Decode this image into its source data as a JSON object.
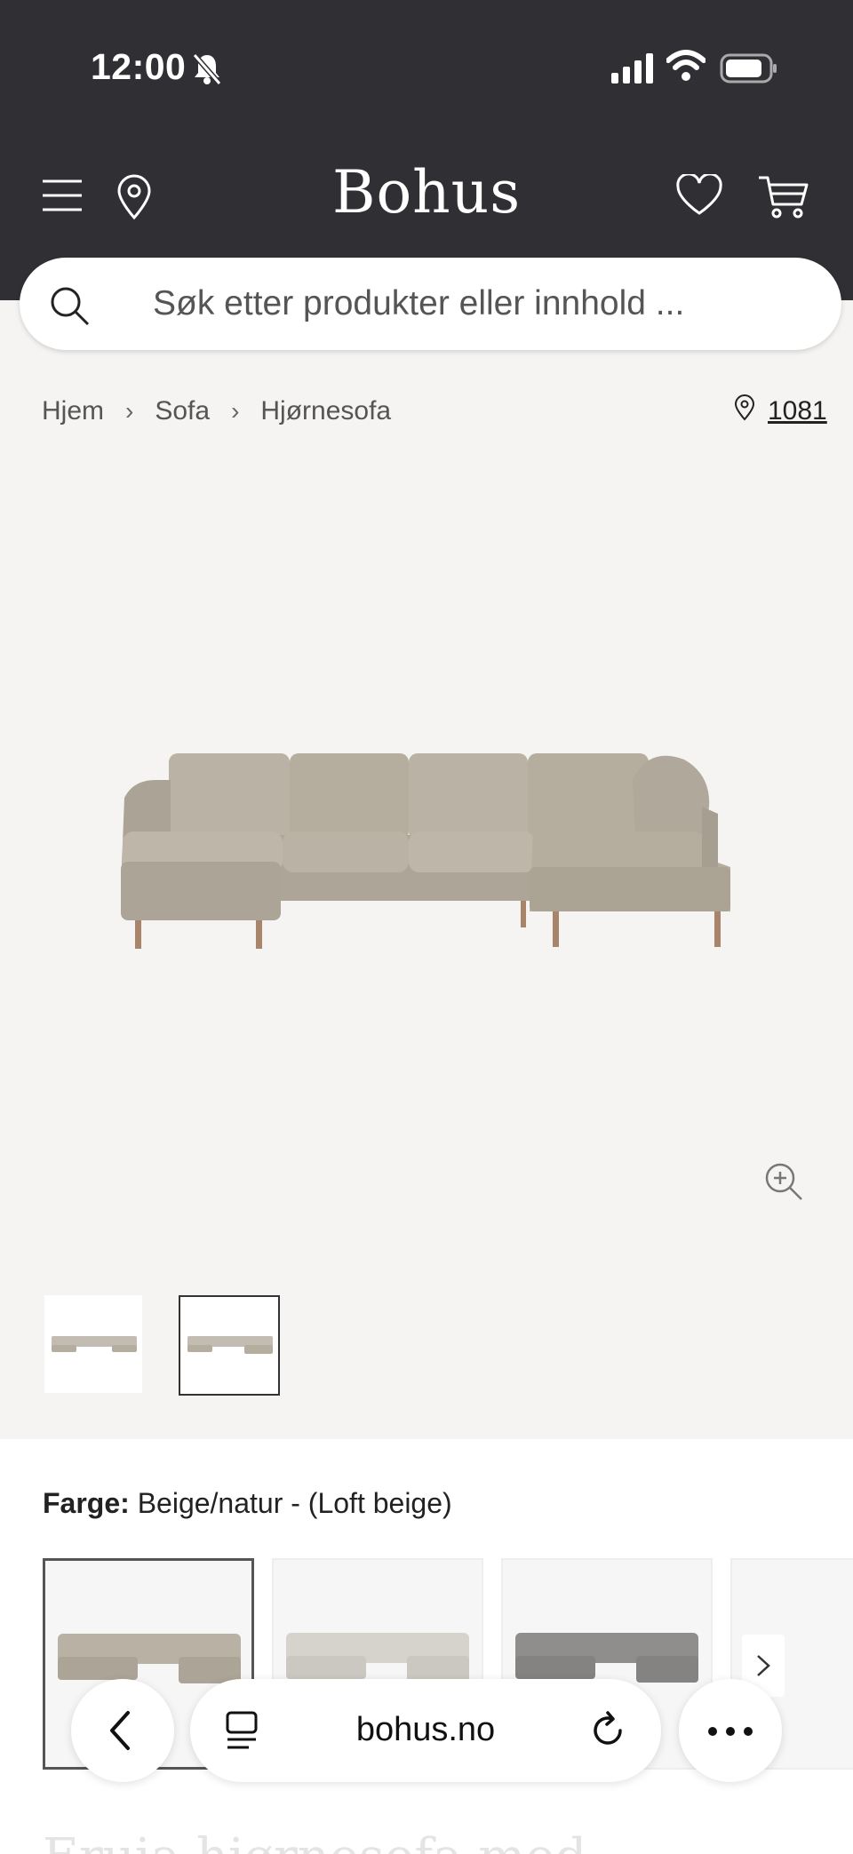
{
  "status_bar": {
    "time": "12:00"
  },
  "header": {
    "brand": "Bohus"
  },
  "search": {
    "placeholder": "Søk etter produkter eller innhold ..."
  },
  "breadcrumb": {
    "items": [
      "Hjem",
      "Sofa",
      "Hjørnesofa"
    ],
    "store_code": "1081"
  },
  "product": {
    "color_label": "Farge:",
    "color_value": "Beige/natur - (Loft beige)",
    "title_partial": "Eruia hjørnesofa med"
  },
  "browser": {
    "url": "bohus.no"
  },
  "colors": {
    "header_bg": "#303034",
    "page_bg": "#f5f4f2",
    "sofa_beige": "#b7b0a3",
    "sofa_light": "#cfccc5",
    "sofa_grey": "#8e8d8b"
  }
}
